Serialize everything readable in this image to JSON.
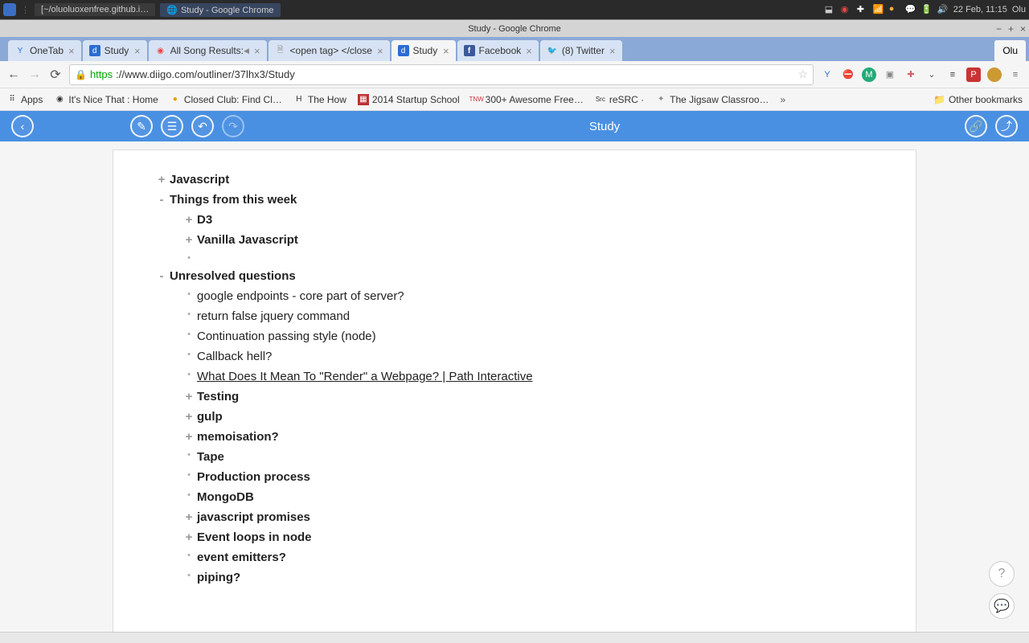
{
  "system": {
    "task1": "[~/oluoluoxenfree.github.i…",
    "task2": "Study - Google Chrome",
    "clock": "22 Feb, 11:15",
    "user": "Olu"
  },
  "chrome": {
    "window_title": "Study - Google Chrome",
    "user_button": "Olu",
    "tabs": [
      {
        "label": "OneTab"
      },
      {
        "label": "Study"
      },
      {
        "label": "All Song Results:"
      },
      {
        "label": "<open tag> </close"
      },
      {
        "label": "Study"
      },
      {
        "label": "Facebook"
      },
      {
        "label": "(8) Twitter"
      }
    ],
    "url_proto": "https",
    "url_rest": "://www.diigo.com/outliner/37lhx3/Study"
  },
  "bookmarks": {
    "apps": "Apps",
    "items": [
      "It's Nice That : Home",
      "Closed Club: Find Cl…",
      "The How",
      "2014 Startup School",
      "300+ Awesome Free…",
      "reSRC ·",
      "The Jigsaw Classroo…"
    ],
    "other": "Other bookmarks"
  },
  "diigo": {
    "title": "Study"
  },
  "outline": [
    {
      "indent": 0,
      "marker": "+",
      "bold": true,
      "text": "Javascript"
    },
    {
      "indent": 0,
      "marker": "-",
      "bold": true,
      "text": "Things from this week"
    },
    {
      "indent": 1,
      "marker": "+",
      "bold": true,
      "text": "D3"
    },
    {
      "indent": 1,
      "marker": "+",
      "bold": true,
      "text": "Vanilla Javascript"
    },
    {
      "indent": 1,
      "marker": "•",
      "bold": false,
      "text": ""
    },
    {
      "indent": 0,
      "marker": "-",
      "bold": true,
      "text": "Unresolved questions"
    },
    {
      "indent": 1,
      "marker": "•",
      "bold": false,
      "text": "google endpoints - core part of server?"
    },
    {
      "indent": 1,
      "marker": "•",
      "bold": false,
      "text": "return false jquery command"
    },
    {
      "indent": 1,
      "marker": "•",
      "bold": false,
      "text": "Continuation passing style (node)"
    },
    {
      "indent": 1,
      "marker": "•",
      "bold": false,
      "text": "Callback hell?"
    },
    {
      "indent": 1,
      "marker": "•",
      "bold": false,
      "text": "What Does It Mean To \"Render\" a Webpage? | Path Interactive",
      "link": true
    },
    {
      "indent": 1,
      "marker": "+",
      "bold": true,
      "text": "Testing"
    },
    {
      "indent": 1,
      "marker": "+",
      "bold": true,
      "text": "gulp"
    },
    {
      "indent": 1,
      "marker": "+",
      "bold": true,
      "text": "memoisation?"
    },
    {
      "indent": 1,
      "marker": "•",
      "bold": true,
      "text": "Tape"
    },
    {
      "indent": 1,
      "marker": "•",
      "bold": true,
      "text": "Production process"
    },
    {
      "indent": 1,
      "marker": "•",
      "bold": true,
      "text": "MongoDB"
    },
    {
      "indent": 1,
      "marker": "+",
      "bold": true,
      "text": "javascript promises"
    },
    {
      "indent": 1,
      "marker": "+",
      "bold": true,
      "text": "Event loops in node"
    },
    {
      "indent": 1,
      "marker": "•",
      "bold": true,
      "text": "event emitters?"
    },
    {
      "indent": 1,
      "marker": "•",
      "bold": true,
      "text": "piping?"
    }
  ]
}
